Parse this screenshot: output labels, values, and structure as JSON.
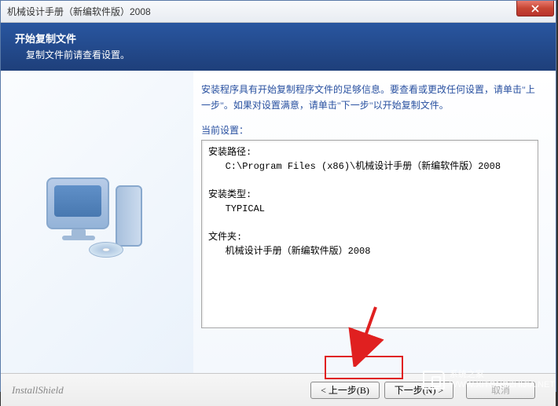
{
  "title": "机械设计手册（新编软件版）2008",
  "header": {
    "title": "开始复制文件",
    "subtitle": "复制文件前请查看设置。"
  },
  "content": {
    "intro": "安装程序具有开始复制程序文件的足够信息。要查看或更改任何设置，请单击\"上一步\"。如果对设置满意，请单击\"下一步\"以开始复制文件。",
    "current_label": "当前设置：",
    "box": "安装路径:\n   C:\\Program Files (x86)\\机械设计手册（新编软件版）2008\n\n安装类型:\n   TYPICAL\n\n文件夹:\n   机械设计手册（新编软件版）2008"
  },
  "footer": {
    "brand": "InstallShield",
    "back": "< 上一步(B)",
    "next": "下一步(N) >",
    "cancel": "取消"
  },
  "watermark": {
    "line1": "系统之家",
    "line2": "WWW.XITONGZHIJIA.NET"
  }
}
